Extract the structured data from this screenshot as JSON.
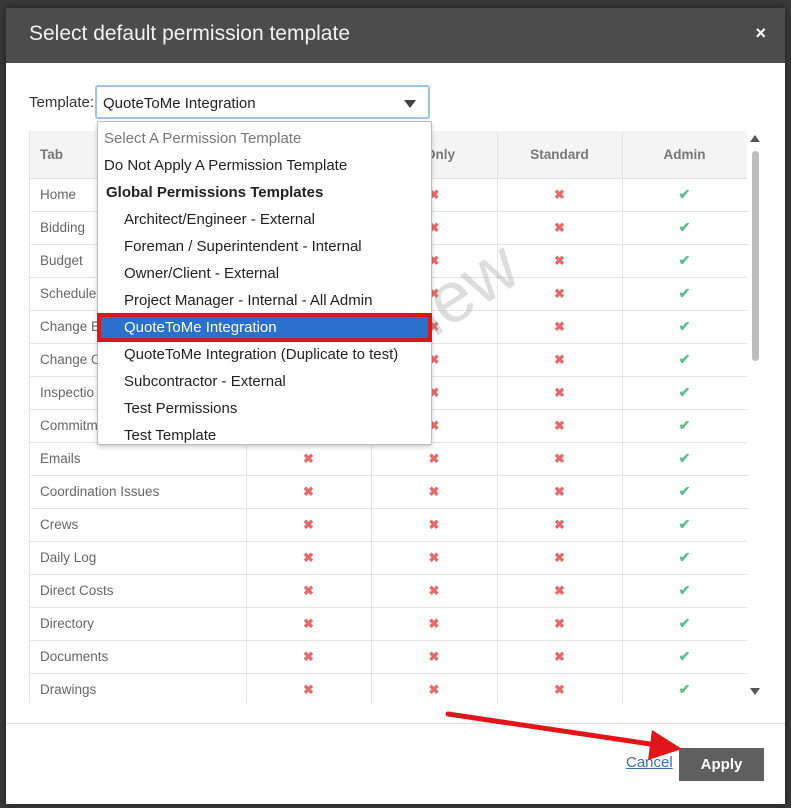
{
  "dialog": {
    "title": "Select default permission template",
    "close_icon": "×"
  },
  "template": {
    "label": "Template:",
    "selected": "QuoteToMe Integration"
  },
  "table": {
    "headers": [
      "Tab",
      "",
      "d Only",
      "Standard",
      "Admin"
    ],
    "rows": [
      {
        "name": "Home",
        "cols": [
          "x",
          "x",
          "x",
          "check"
        ]
      },
      {
        "name": "Bidding",
        "cols": [
          "x",
          "x",
          "x",
          "check"
        ]
      },
      {
        "name": "Budget",
        "cols": [
          "x",
          "x",
          "x",
          "check"
        ]
      },
      {
        "name": "Schedule",
        "cols": [
          "x",
          "x",
          "x",
          "check"
        ]
      },
      {
        "name": "Change E",
        "cols": [
          "x",
          "x",
          "x",
          "check"
        ]
      },
      {
        "name": "Change O",
        "cols": [
          "x",
          "x",
          "x",
          "check"
        ]
      },
      {
        "name": "Inspectio",
        "cols": [
          "x",
          "x",
          "x",
          "check"
        ]
      },
      {
        "name": "Commitm",
        "cols": [
          "x",
          "x",
          "x",
          "check"
        ]
      },
      {
        "name": "Emails",
        "cols": [
          "x",
          "x",
          "x",
          "check"
        ]
      },
      {
        "name": "Coordination Issues",
        "cols": [
          "x",
          "x",
          "x",
          "check"
        ]
      },
      {
        "name": "Crews",
        "cols": [
          "x",
          "x",
          "x",
          "check"
        ]
      },
      {
        "name": "Daily Log",
        "cols": [
          "x",
          "x",
          "x",
          "check"
        ]
      },
      {
        "name": "Direct Costs",
        "cols": [
          "x",
          "x",
          "x",
          "check"
        ]
      },
      {
        "name": "Directory",
        "cols": [
          "x",
          "x",
          "x",
          "check"
        ]
      },
      {
        "name": "Documents",
        "cols": [
          "x",
          "x",
          "x",
          "check"
        ]
      },
      {
        "name": "Drawings",
        "cols": [
          "x",
          "x",
          "x",
          "check"
        ]
      }
    ]
  },
  "dropdown": {
    "placeholder": "Select A Permission Template",
    "no_apply": "Do Not Apply A Permission Template",
    "group_label": "Global Permissions Templates",
    "options": [
      "Architect/Engineer - External",
      "Foreman / Superintendent - Internal",
      "Owner/Client - External",
      "Project Manager - Internal - All Admin",
      "QuoteToMe Integration",
      "QuoteToMe Integration (Duplicate to test)",
      "Subcontractor - External",
      "Test Permissions",
      "Test Template"
    ],
    "selected_index": 4
  },
  "watermark": "Preview",
  "footer": {
    "cancel": "Cancel",
    "apply": "Apply"
  },
  "colors": {
    "header_bg": "#4c4c4c",
    "selected_bg": "#2b71cc",
    "highlight_border": "#d61a1a",
    "x_color": "#e46b6b",
    "check_color": "#5cc08d",
    "apply_bg": "#5f5f5f"
  }
}
